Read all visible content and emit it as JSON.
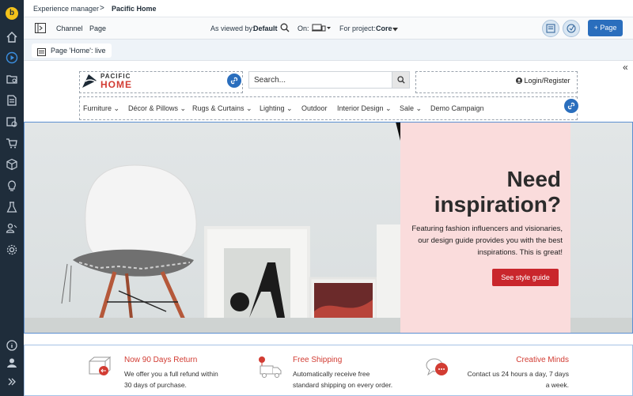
{
  "breadcrumb": {
    "section": "Experience manager",
    "separator": ">",
    "page": "Pacific Home"
  },
  "toolbar": {
    "channel_label": "Channel",
    "page_label": "Page",
    "viewed_by_label": "As viewed by:",
    "viewed_by_value": "Default",
    "on_label": "On:",
    "project_label": "For project:",
    "project_value": "Core",
    "add_page_label": "+ Page"
  },
  "status": {
    "page_status": "Page 'Home': live"
  },
  "site": {
    "logo_line1": "PACIFIC",
    "logo_line2": "HOME",
    "search_placeholder": "Search...",
    "login_label": "Login/Register",
    "nav": [
      "Furniture",
      "Décor & Pillows",
      "Rugs & Curtains",
      "Lighting",
      "Outdoor",
      "Interior Design",
      "Sale",
      "Demo Campaign"
    ],
    "nav_dropdown": [
      true,
      true,
      true,
      true,
      false,
      true,
      true,
      false
    ]
  },
  "hero": {
    "headline_line1": "Need",
    "headline_line2": "inspiration?",
    "body": "Featuring fashion influencers and visionaries, our design guide provides you with the best inspirations. This is great!",
    "cta": "See style guide"
  },
  "features": [
    {
      "title": "Now 90 Days Return",
      "line1": "We offer you a full refund within",
      "line2": "30 days of purchase."
    },
    {
      "title": "Free Shipping",
      "line1": "Automatically receive free",
      "line2": "standard shipping on every order."
    },
    {
      "title": "Creative Minds",
      "line1": "Contact us 24 hours a day, 7 days",
      "line2": "a week."
    }
  ],
  "colors": {
    "accent": "#2a6ebd",
    "brand_red": "#d23c33",
    "rail": "#1f2d3b",
    "promo_bg": "#fadcdc"
  },
  "rail_icons": [
    "home-icon",
    "play-icon",
    "folder-settings-icon",
    "document-icon",
    "image-icon",
    "cart-icon",
    "box-icon",
    "lightbulb-icon",
    "flask-icon",
    "users-icon",
    "gear-icon",
    "help-icon",
    "user-icon",
    "expand-icon"
  ]
}
